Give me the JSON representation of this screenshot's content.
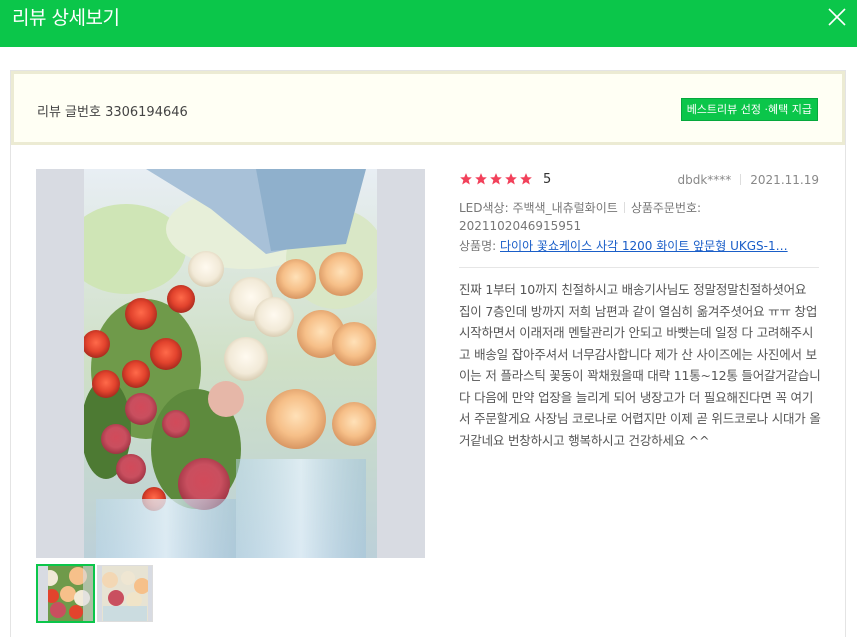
{
  "window": {
    "title": "리뷰 상세보기",
    "close_icon": "close-icon"
  },
  "header": {
    "review_number_text": "리뷰 글번호 3306194646",
    "best_review_badge": "베스트리뷰 선정 ·혜택 지급"
  },
  "review": {
    "rating_stars": 5,
    "rating_value": "5",
    "user": "dbdk****",
    "date": "2021.11.19",
    "option": "LED색상: 주백색_내츄럴화이트",
    "order_number_label": "상품주문번호:",
    "order_number": "2021102046915951",
    "product_label": "상품명:",
    "product_name": "다이아 꽃쇼케이스 사각 1200 화이트 앞문형 UKGS-1…",
    "text": "진짜 1부터 10까지 친절하시고 배송기사님도 정말정말친절하셧어요 집이 7층인데 방까지 저희 남편과 같이 열심히 옮겨주셧어요 ㅠㅠ 창업시작하면서 이래저래 멘탈관리가 안되고 바빳는데 일정 다 고려해주시고 배송일 잡아주셔서 너무감사합니다 제가 산 사이즈에는 사진에서 보이는 저 플라스틱 꽃동이 꽉채웠을때 대략 11통~12통 들어갈거같습니다 다음에 만약 업장을 늘리게 되어 냉장고가 더 필요해진다면 꼭 여기서 주문할게요 사장님 코로나로 어렵지만 이제 곧 위드코로나 시대가 올거같네요 번창하시고 행복하시고 건강하세요 ^^"
  },
  "colors": {
    "brand_green": "#0bc64a",
    "star_red": "#f2405a",
    "link_blue": "#1a5ec8"
  },
  "icons": {
    "star": "star-icon",
    "close": "close-icon"
  }
}
